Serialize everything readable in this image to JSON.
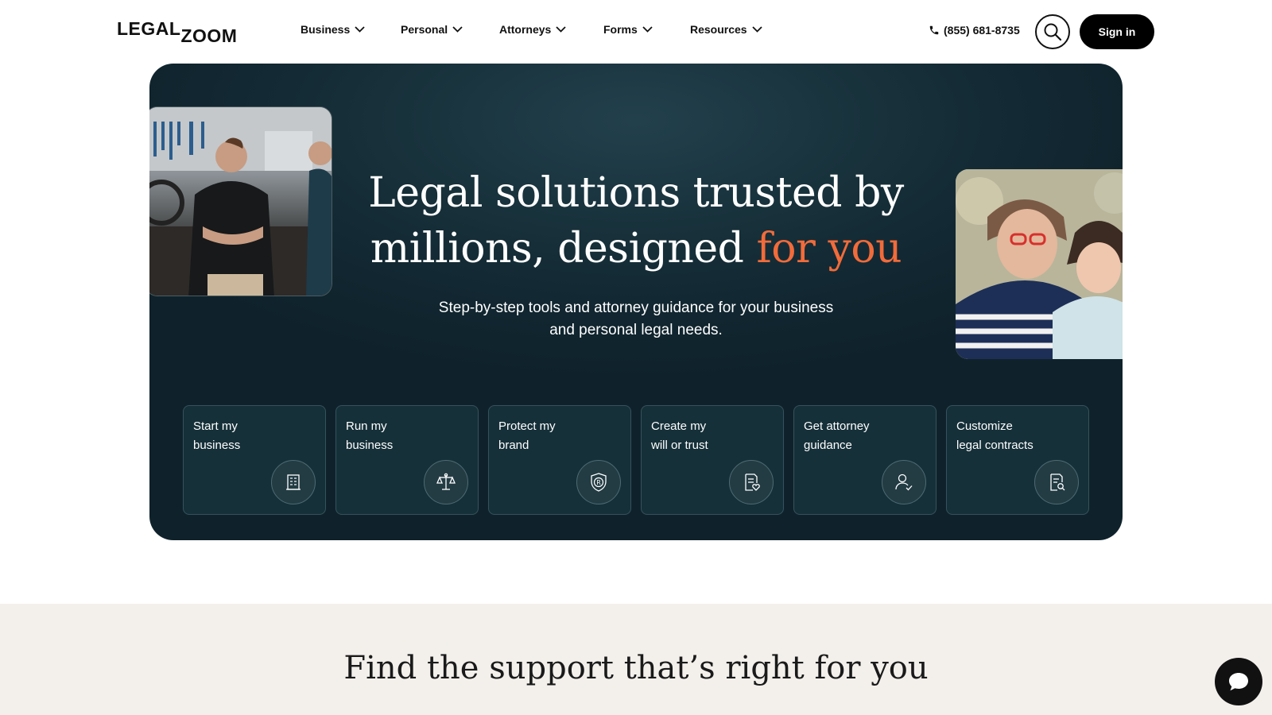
{
  "header": {
    "logo": {
      "part1": "LEGAL",
      "part2": "ZOOM"
    },
    "nav": [
      {
        "label": "Business"
      },
      {
        "label": "Personal"
      },
      {
        "label": "Attorneys"
      },
      {
        "label": "Forms"
      },
      {
        "label": "Resources"
      }
    ],
    "phone": "(855) 681-8735",
    "signin_label": "Sign in"
  },
  "hero": {
    "title_line1": "Legal solutions trusted by",
    "title_line2_main": "millions, designed ",
    "title_line2_accent": "for you",
    "accent_color": "#f26b3a",
    "subtitle": "Step-by-step tools and attorney guidance for your business and personal legal needs.",
    "cards": [
      {
        "label": "Start my\nbusiness",
        "icon": "building-icon"
      },
      {
        "label": "Run my\nbusiness",
        "icon": "scales-icon"
      },
      {
        "label": "Protect my\nbrand",
        "icon": "trademark-shield-icon"
      },
      {
        "label": "Create my\nwill or trust",
        "icon": "document-heart-icon"
      },
      {
        "label": "Get attorney\nguidance",
        "icon": "person-check-icon"
      },
      {
        "label": "Customize\nlegal contracts",
        "icon": "document-search-icon"
      }
    ]
  },
  "support": {
    "title": "Find the support that’s right for you"
  }
}
